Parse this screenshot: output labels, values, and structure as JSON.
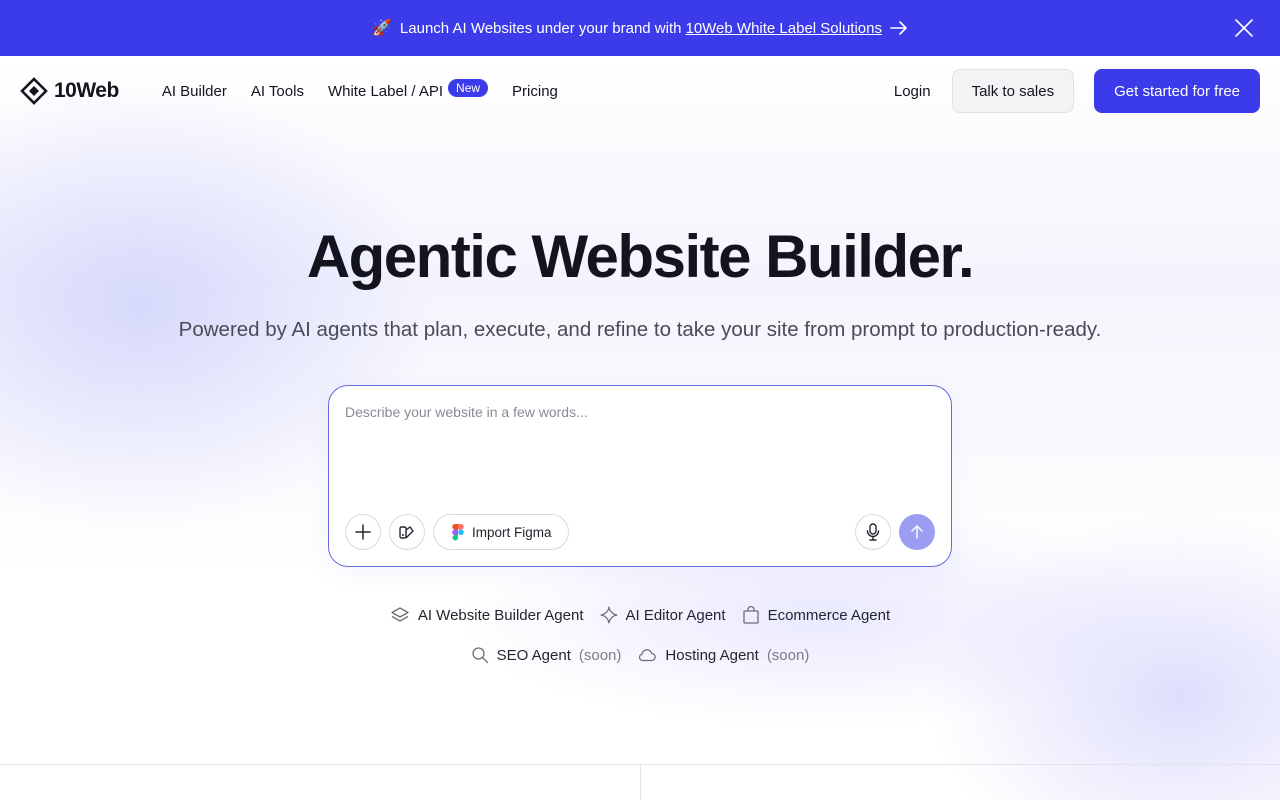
{
  "announcement": {
    "emoji": "🚀",
    "text": "Launch AI Websites under your brand with",
    "link_text": "10Web White Label Solutions"
  },
  "header": {
    "logo_text": "10Web",
    "nav": [
      {
        "label": "AI Builder"
      },
      {
        "label": "AI Tools"
      },
      {
        "label": "White Label / API",
        "badge": "New"
      },
      {
        "label": "Pricing"
      }
    ],
    "login_label": "Login",
    "sales_label": "Talk to sales",
    "start_label": "Get started for free"
  },
  "hero": {
    "title": "Agentic Website Builder.",
    "subtitle": "Powered by AI agents that plan, execute, and refine to take your site from prompt to production-ready."
  },
  "prompt": {
    "placeholder": "Describe your website in a few words...",
    "value": "",
    "figma_label": "Import Figma"
  },
  "agents": {
    "row1": [
      {
        "label": "AI Website Builder Agent",
        "icon": "layers-icon"
      },
      {
        "label": "AI Editor Agent",
        "icon": "sparkle-icon"
      },
      {
        "label": "Ecommerce Agent",
        "icon": "shopping-bag-icon"
      }
    ],
    "row2": [
      {
        "label": "SEO Agent",
        "status": "(soon)",
        "icon": "search-icon"
      },
      {
        "label": "Hosting Agent",
        "status": "(soon)",
        "icon": "cloud-icon"
      }
    ]
  },
  "colors": {
    "brand": "#3b3bea",
    "send_button": "#9b9cf4",
    "text": "#14141f"
  }
}
